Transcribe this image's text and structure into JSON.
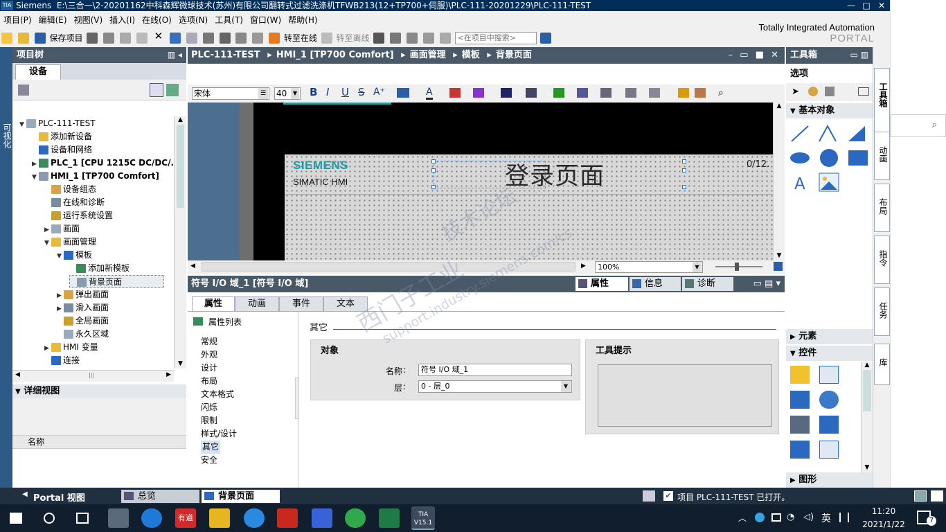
{
  "titlebar": {
    "app": "Siemens",
    "path": "E:\\三合一\\2-20201162中科森辉微球技术(苏州)有限公司翻转式过滤洗涤机TFWB213(12+TP700+伺服)\\PLC-111-20201229\\PLC-111-TEST",
    "logo": "TIA"
  },
  "window_controls": {
    "min": "—",
    "max": "□",
    "close": "✕"
  },
  "menu": [
    "项目(P)",
    "编辑(E)",
    "视图(V)",
    "插入(I)",
    "在线(O)",
    "选项(N)",
    "工具(T)",
    "窗口(W)",
    "帮助(H)"
  ],
  "toolbar": {
    "save_label": "保存项目",
    "go_online": "转至在线",
    "go_offline": "转至离线",
    "search_placeholder": "<在项目中搜索>"
  },
  "brand": {
    "line1": "Totally Integrated Automation",
    "line2": "PORTAL"
  },
  "left_strip": "可视化",
  "project_tree": {
    "title": "项目树",
    "tab": "设备",
    "items": [
      {
        "label": "PLC-111-TEST",
        "level": 0,
        "expand": "▼"
      },
      {
        "label": "添加新设备",
        "level": 1,
        "expand": ""
      },
      {
        "label": "设备和网络",
        "level": 1,
        "expand": ""
      },
      {
        "label": "PLC_1 [CPU 1215C DC/DC/...",
        "level": 1,
        "expand": "▶"
      },
      {
        "label": "HMI_1 [TP700 Comfort]",
        "level": 1,
        "expand": "▼"
      },
      {
        "label": "设备组态",
        "level": 2,
        "expand": ""
      },
      {
        "label": "在线和诊断",
        "level": 2,
        "expand": ""
      },
      {
        "label": "运行系统设置",
        "level": 2,
        "expand": ""
      },
      {
        "label": "画面",
        "level": 2,
        "expand": "▶"
      },
      {
        "label": "画面管理",
        "level": 2,
        "expand": "▼"
      },
      {
        "label": "模板",
        "level": 3,
        "expand": "▼"
      },
      {
        "label": "添加新模板",
        "level": 4,
        "expand": ""
      },
      {
        "label": "背景页面",
        "level": 4,
        "expand": ""
      },
      {
        "label": "弹出画面",
        "level": 3,
        "expand": "▶"
      },
      {
        "label": "滑入画面",
        "level": 3,
        "expand": "▶"
      },
      {
        "label": "全局画面",
        "level": 3,
        "expand": ""
      },
      {
        "label": "永久区域",
        "level": 3,
        "expand": ""
      },
      {
        "label": "HMI 变量",
        "level": 2,
        "expand": "▶"
      },
      {
        "label": "连接",
        "level": 2,
        "expand": ""
      }
    ],
    "selected_index": 12
  },
  "detail_view": {
    "title": "详细视图",
    "col_name": "名称"
  },
  "editor": {
    "breadcrumb": [
      "PLC-111-TEST",
      "HMI_1 [TP700 Comfort]",
      "画面管理",
      "模板",
      "背景页面"
    ],
    "font_name": "宋体",
    "font_size": "40",
    "zoom": "100%",
    "screen": {
      "brand": "SIEMENS",
      "model": "SIMATIC HMI",
      "title": "登录页面",
      "io_field": "0/12."
    }
  },
  "watermark": {
    "line1": "西门子工业",
    "line2": "support.industry.siemens.com/cs",
    "line3": "技术论坛"
  },
  "inspector": {
    "title": "符号 I/O 域_1 [符号 I/O 域]",
    "right_tabs": [
      "属性",
      "信息",
      "诊断"
    ],
    "tabs": [
      "属性",
      "动画",
      "事件",
      "文本"
    ],
    "list_header": "属性列表",
    "list": [
      "常规",
      "外观",
      "设计",
      "布局",
      "文本格式",
      "闪烁",
      "限制",
      "样式/设计",
      "其它",
      "安全"
    ],
    "selected_list": "其它",
    "section_title": "其它",
    "group_object": "对象",
    "name_label": "名称",
    "name_value": "符号 I/O 域_1",
    "layer_label": "层",
    "layer_value": "0 - 层_0",
    "group_tooltip": "工具提示"
  },
  "toolbox": {
    "title": "工具箱",
    "options": "选项",
    "basic_objects": "基本对象",
    "elements": "元素",
    "controls": "控件",
    "graphics": "图形",
    "side_tabs": [
      "工具箱",
      "动画",
      "布局",
      "指令",
      "任务",
      "库"
    ]
  },
  "statusbar": {
    "portal_view": "Portal 视图",
    "overview": "总览",
    "current": "背景页面",
    "message": "项目 PLC-111-TEST 已打开。"
  },
  "taskbar": {
    "time": "11:20",
    "date": "2021/1/22",
    "ime": "英",
    "notif_count": "7",
    "app_label": "有道",
    "tia_label": "TIA V15.1"
  }
}
